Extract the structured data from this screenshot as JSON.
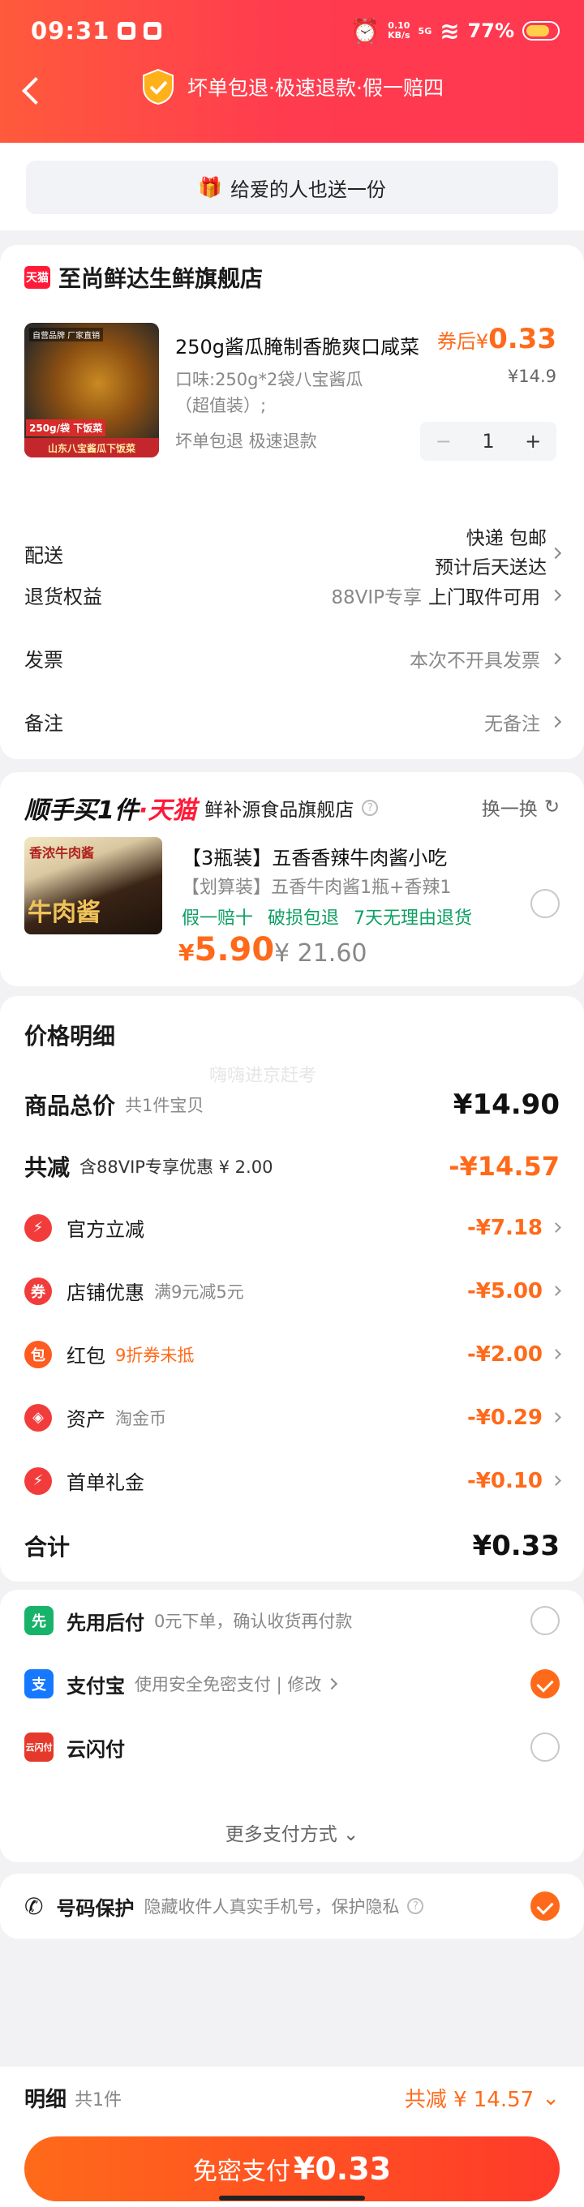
{
  "status": {
    "time": "09:31",
    "net_speed": "0.10",
    "net_unit": "KB/s",
    "signal": "5G",
    "battery": "77%"
  },
  "header": {
    "guarantee": "坏单包退·极速退款·假一赔四"
  },
  "gift": {
    "label": "给爱的人也送一份"
  },
  "shop": {
    "badge": "天猫",
    "name": "至尚鲜达生鲜旗舰店",
    "product": {
      "img_tag1": "自营品牌 厂家直销",
      "img_tag2": "250g/袋 下饭菜",
      "img_tag3": "山东八宝酱瓜下饭菜",
      "title": "250g酱瓜腌制香脆爽口咸菜",
      "price_prefix": "券后¥",
      "price": "0.33",
      "spec_line1": "口味:250g*2袋八宝酱瓜",
      "spec_line2": "（超值装）;",
      "orig_price": "¥14.9",
      "services": "坏单包退  极速退款",
      "qty_minus": "−",
      "qty": "1",
      "qty_plus": "+"
    },
    "delivery": {
      "label": "配送",
      "method": "快递 包邮",
      "eta": "预计后天送达"
    },
    "returns": {
      "label": "退货权益",
      "vip": "88VIP专享",
      "value": "上门取件可用"
    },
    "invoice": {
      "label": "发票",
      "value": "本次不开具发票"
    },
    "note": {
      "label": "备注",
      "value": "无备注"
    }
  },
  "promo": {
    "logo_a": "顺手买1件",
    "logo_b": "·天猫",
    "shop": "鲜补源食品旗舰店",
    "info": "?",
    "swap": "换一换",
    "img_t1": "香浓牛肉酱",
    "img_t2": "牛肉酱",
    "title": "【3瓶装】五香香辣牛肉酱小吃",
    "sub": "【划算装】五香牛肉酱1瓶+香辣1",
    "tags": [
      "假一赔十",
      "破损包退",
      "7天无理由退货"
    ],
    "price_symbol": "¥",
    "price": "5.90",
    "orig_price": "¥ 21.60"
  },
  "price_detail": {
    "title": "价格明细",
    "watermark": "嗨嗨进京赶考",
    "total_goods": {
      "label": "商品总价",
      "sub": "共1件宝贝",
      "amount": "¥14.90"
    },
    "total_discount": {
      "label": "共减",
      "sub": "含88VIP专享优惠 ¥ 2.00",
      "amount": "-¥14.57"
    },
    "items": [
      {
        "label": "官方立减",
        "sub": "",
        "amount": "-¥7.18",
        "icon": "lightning-icon",
        "glyph": "⚡"
      },
      {
        "label": "店铺优惠",
        "sub": "满9元减5元",
        "amount": "-¥5.00",
        "icon": "shop-coupon-icon",
        "glyph": "券"
      },
      {
        "label": "红包",
        "sub": "9折券未抵",
        "amount": "-¥2.00",
        "icon": "red-envelope-icon",
        "glyph": "包"
      },
      {
        "label": "资产",
        "sub": "淘金币",
        "amount": "-¥0.29",
        "icon": "asset-tag-icon",
        "glyph": "◈"
      },
      {
        "label": "首单礼金",
        "sub": "",
        "amount": "-¥0.10",
        "icon": "lightning-icon",
        "glyph": "⚡"
      }
    ],
    "sum": {
      "label": "合计",
      "amount": "¥0.33"
    }
  },
  "payment": {
    "methods": [
      {
        "name": "先用后付",
        "desc": "0元下单，确认收货再付款",
        "icon": "pay-later-icon",
        "glyph": "先",
        "selected": false
      },
      {
        "name": "支付宝",
        "desc": "使用安全免密支付 | 修改",
        "icon": "alipay-icon",
        "glyph": "支",
        "selected": true
      },
      {
        "name": "云闪付",
        "desc": "",
        "icon": "unionpay-icon",
        "glyph": "云闪付",
        "selected": false
      }
    ],
    "more": "更多支付方式"
  },
  "protect": {
    "label": "号码保护",
    "desc": "隐藏收件人真实手机号，保护隐私",
    "info": "?"
  },
  "bottom": {
    "detail": "明细",
    "count": "共1件",
    "saved": "共减 ¥ 14.57",
    "pay_label": "免密支付",
    "pay_amount": "¥0.33"
  },
  "colors": {
    "accent": "#ff6a1a",
    "header": "#ff3b4f",
    "tmall": "#ff1a38",
    "green": "#0d9f63"
  }
}
